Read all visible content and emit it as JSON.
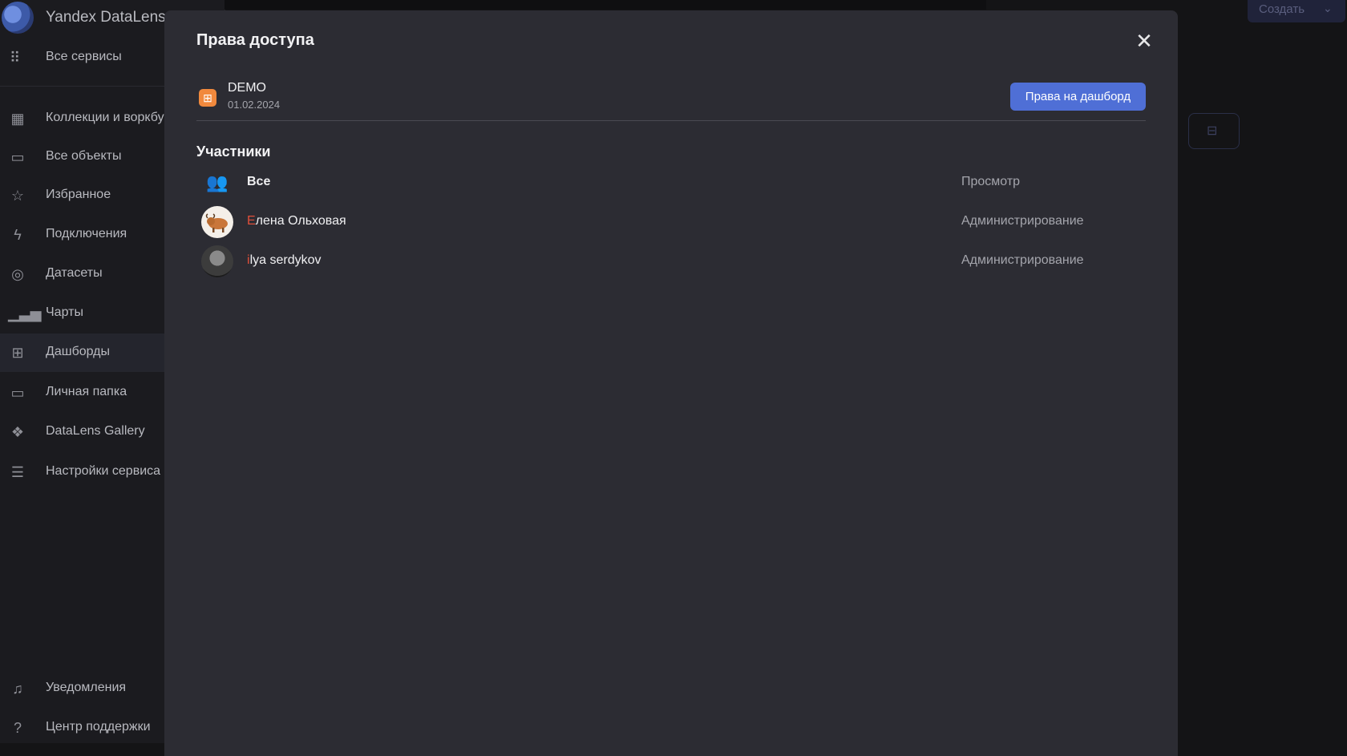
{
  "app": {
    "name": "Yandex DataLens"
  },
  "sidebar": {
    "all_services": "Все сервисы",
    "items": [
      {
        "label": "Коллекции и воркбуки",
        "icon": "collections-icon"
      },
      {
        "label": "Все объекты",
        "icon": "folders-icon"
      },
      {
        "label": "Избранное",
        "icon": "star-icon"
      },
      {
        "label": "Подключения",
        "icon": "lightning-icon"
      },
      {
        "label": "Датасеты",
        "icon": "datasets-icon"
      },
      {
        "label": "Чарты",
        "icon": "chart-bars-icon"
      },
      {
        "label": "Дашборды",
        "icon": "dashboard-icon"
      },
      {
        "label": "Личная папка",
        "icon": "personal-folder-icon"
      },
      {
        "label": "DataLens Gallery",
        "icon": "gallery-icon"
      },
      {
        "label": "Настройки сервиса",
        "icon": "sliders-icon"
      }
    ],
    "bottom": [
      {
        "label": "Уведомления",
        "icon": "bell-icon"
      },
      {
        "label": "Центр поддержки",
        "icon": "help-icon"
      }
    ]
  },
  "header": {
    "create_label": "Создать"
  },
  "modal": {
    "title": "Права доступа",
    "object": {
      "name": "DEMO",
      "date": "01.02.2024"
    },
    "rights_button": "Права на дашборд",
    "section_title": "Участники",
    "members": [
      {
        "first": "",
        "rest": "Все",
        "role": "Просмотр"
      },
      {
        "first": "Е",
        "rest": "лена Ольховая",
        "role": "Администрирование"
      },
      {
        "first": "i",
        "rest": "lya serdykov",
        "role": "Администрирование"
      }
    ]
  },
  "colors": {
    "accent": "#4f6fd6",
    "object_icon": "#f1893d",
    "modal_bg": "#2c2c33"
  }
}
